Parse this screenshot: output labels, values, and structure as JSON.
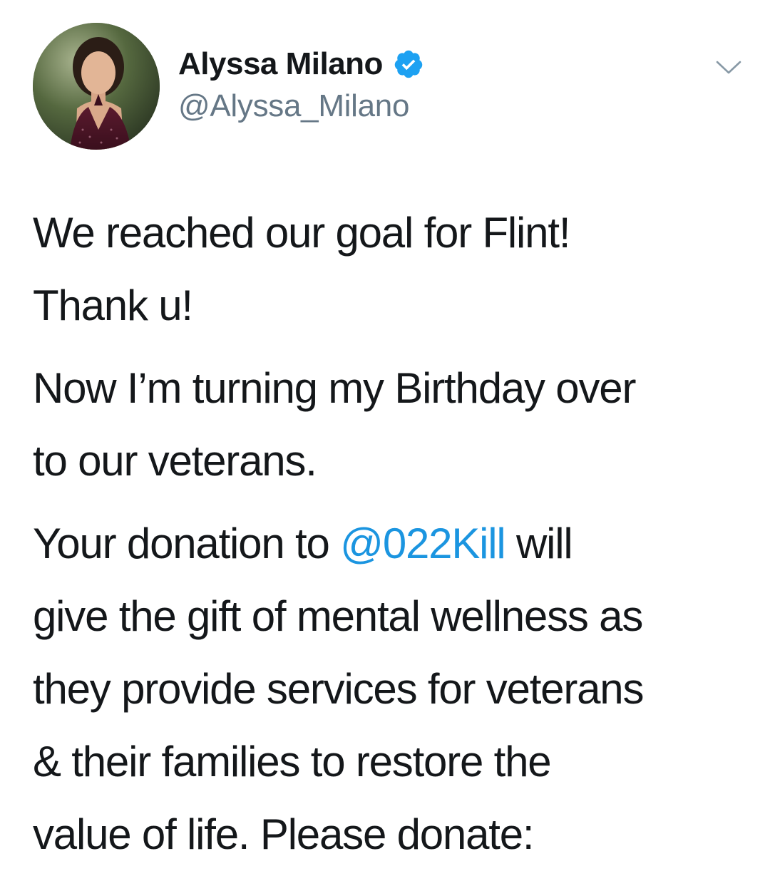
{
  "tweet": {
    "author": {
      "display_name": "Alyssa Milano",
      "handle": "@Alyssa_Milano",
      "verified": true,
      "avatar_icon": "avatar-photo"
    },
    "menu_icon": "chevron-down-icon",
    "colors": {
      "text": "#14171a",
      "handle": "#657786",
      "mention": "#1b95e0",
      "verified": "#1da1f2"
    },
    "paragraphs": [
      {
        "lines": [
          "We reached our goal for Flint!",
          "Thank u!"
        ]
      },
      {
        "lines": [
          "Now I’m turning my Birthday over",
          "to our veterans."
        ]
      },
      {
        "pre_mention": "Your donation to ",
        "mention": "@022Kill",
        "post_mention": " will",
        "lines": [
          "give the gift of mental wellness as",
          "they provide services for veterans",
          "& their families to restore the",
          "value of life. Please donate:"
        ]
      }
    ]
  }
}
